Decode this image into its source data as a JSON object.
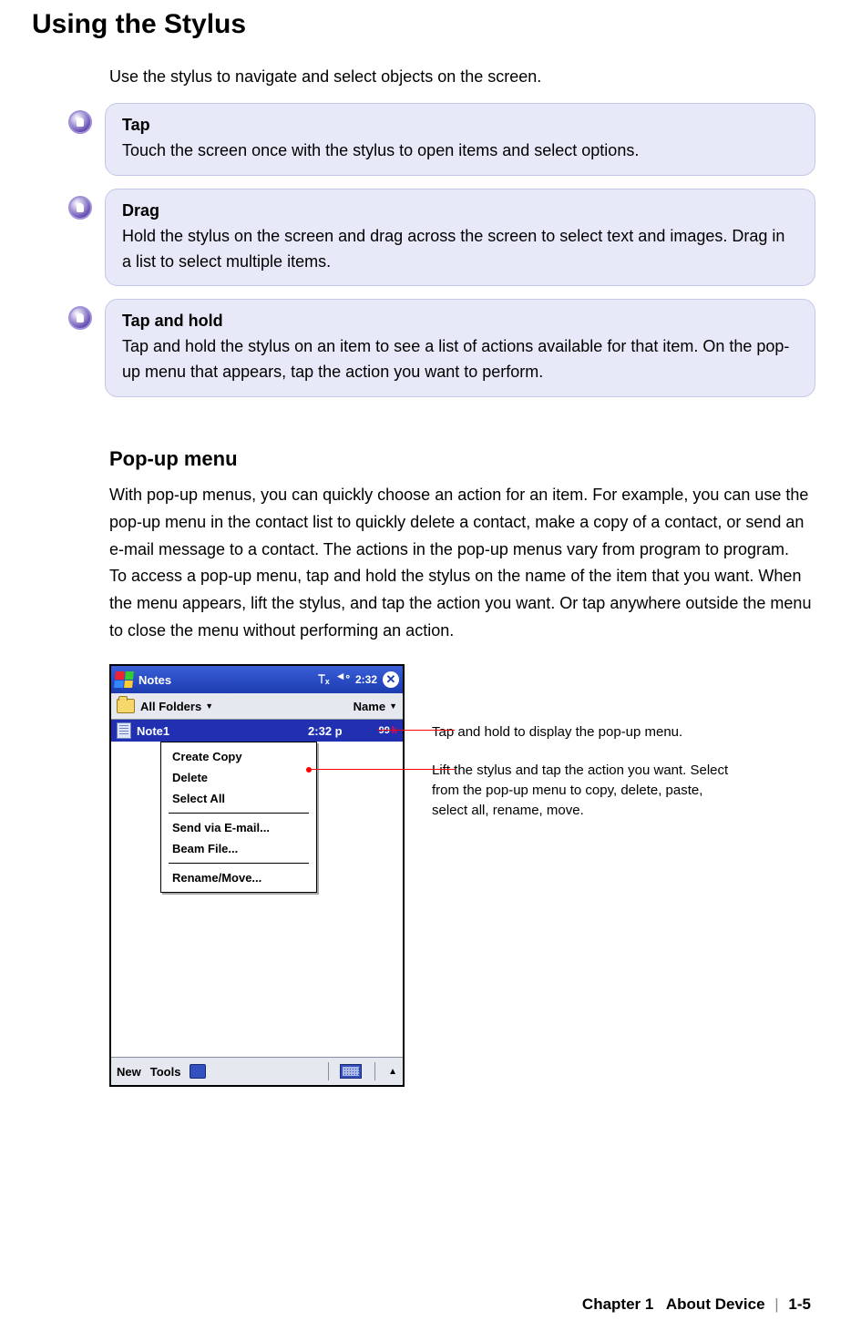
{
  "title": "Using the Stylus",
  "intro": "Use the stylus to navigate and select objects on the screen.",
  "tips": [
    {
      "title": "Tap",
      "body": "Touch the screen once with the stylus to open items and select options."
    },
    {
      "title": "Drag",
      "body": "Hold the stylus on the screen and drag across the screen to select text and images. Drag in a list to select multiple items."
    },
    {
      "title": "Tap and hold",
      "body": "Tap and hold the stylus on an item to see a list of actions available for that item. On the pop-up menu that appears, tap the action you want to perform."
    }
  ],
  "section2": {
    "title": "Pop-up menu",
    "para1": "With pop-up menus, you can quickly choose an action for an item. For example, you can use the pop-up menu in the contact list to quickly delete a contact, make a copy of a contact, or send an e-mail message to a contact. The actions in the pop-up menus vary from program to program.",
    "para2": "To access a pop-up menu, tap and hold the stylus on the name of the item that you want. When the menu appears, lift the stylus, and tap the action you want. Or tap anywhere outside the menu to close the menu without performing an action."
  },
  "device": {
    "app_title": "Notes",
    "clock": "2:32",
    "toolbar": {
      "folders": "All Folders",
      "sort": "Name"
    },
    "row": {
      "name": "Note1",
      "time": "2:32 p",
      "size": "99",
      "size_suffix": "k"
    },
    "menu": {
      "items": [
        "Create Copy",
        "Delete",
        "Select All",
        "Send via E-mail...",
        "Beam File...",
        "Rename/Move..."
      ]
    },
    "bottom": {
      "new": "New",
      "tools": "Tools"
    }
  },
  "callouts": {
    "c1": "Tap and hold to display the pop-up menu.",
    "c2": "Lift the stylus and tap the action you want. Select from the pop-up menu to copy, delete, paste, select all, rename, move."
  },
  "footer": {
    "chapter": "Chapter 1",
    "section": "About Device",
    "page": "1-5"
  }
}
